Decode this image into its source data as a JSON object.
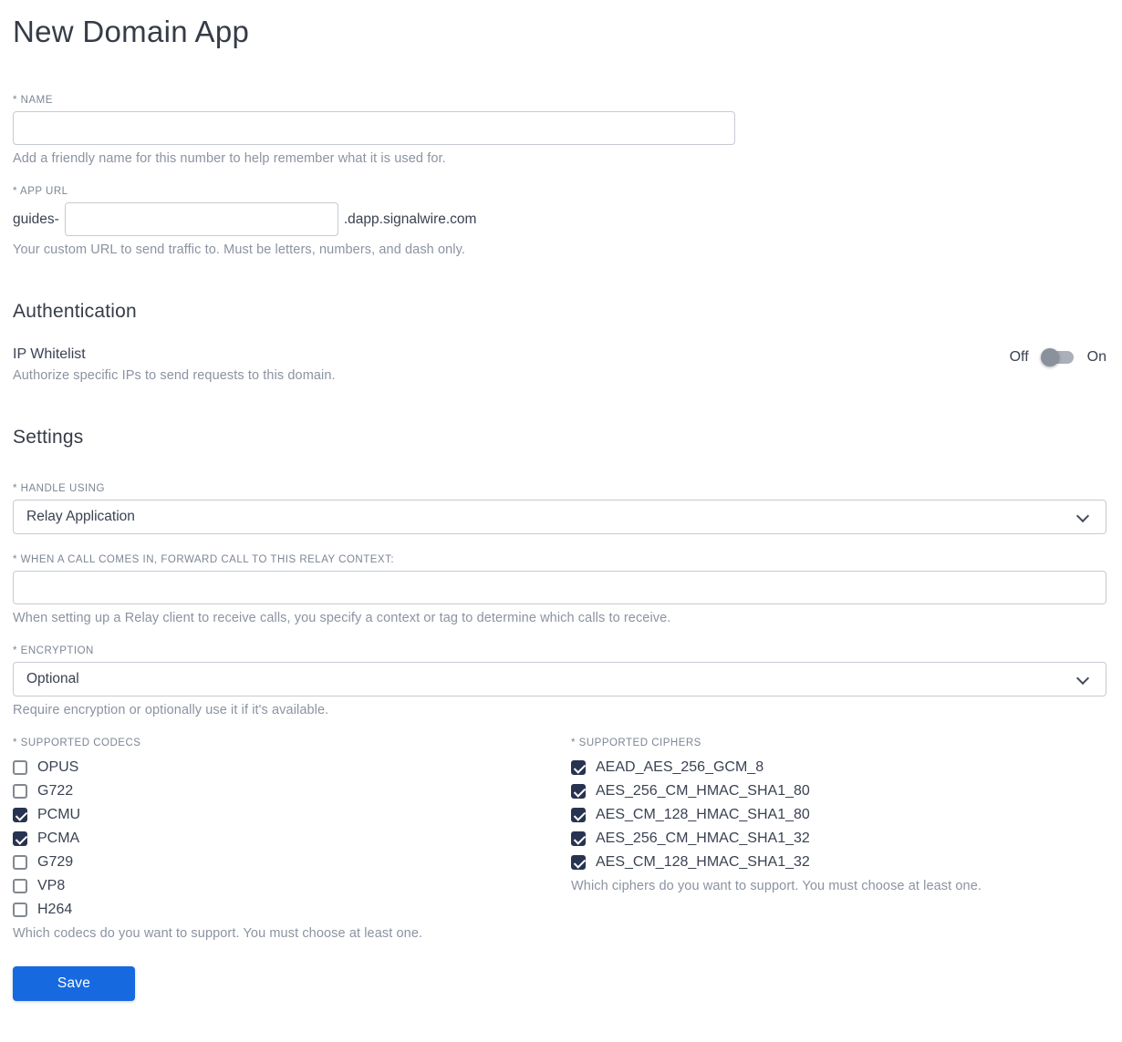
{
  "page": {
    "title": "New Domain App"
  },
  "name_field": {
    "label": "* NAME",
    "value": "",
    "helper": "Add a friendly name for this number to help remember what it is used for."
  },
  "app_url_field": {
    "label": "* APP URL",
    "prefix": "guides-",
    "value": "",
    "suffix": ".dapp.signalwire.com",
    "helper": "Your custom URL to send traffic to. Must be letters, numbers, and dash only."
  },
  "authentication": {
    "heading": "Authentication",
    "ip_whitelist": {
      "label": "IP Whitelist",
      "helper": "Authorize specific IPs to send requests to this domain.",
      "off_label": "Off",
      "on_label": "On",
      "enabled": false
    }
  },
  "settings": {
    "heading": "Settings",
    "handle_using": {
      "label": "* HANDLE USING",
      "value": "Relay Application"
    },
    "relay_context": {
      "label": "* WHEN A CALL COMES IN, FORWARD CALL TO THIS RELAY CONTEXT:",
      "value": "",
      "helper": "When setting up a Relay client to receive calls, you specify a context or tag to determine which calls to receive."
    },
    "encryption": {
      "label": "* ENCRYPTION",
      "value": "Optional",
      "helper": "Require encryption or optionally use it if it's available."
    },
    "codecs": {
      "label": "* SUPPORTED CODECS",
      "helper": "Which codecs do you want to support. You must choose at least one.",
      "items": [
        {
          "label": "OPUS",
          "checked": false
        },
        {
          "label": "G722",
          "checked": false
        },
        {
          "label": "PCMU",
          "checked": true
        },
        {
          "label": "PCMA",
          "checked": true
        },
        {
          "label": "G729",
          "checked": false
        },
        {
          "label": "VP8",
          "checked": false
        },
        {
          "label": "H264",
          "checked": false
        }
      ]
    },
    "ciphers": {
      "label": "* SUPPORTED CIPHERS",
      "helper": "Which ciphers do you want to support. You must choose at least one.",
      "items": [
        {
          "label": "AEAD_AES_256_GCM_8",
          "checked": true
        },
        {
          "label": "AES_256_CM_HMAC_SHA1_80",
          "checked": true
        },
        {
          "label": "AES_CM_128_HMAC_SHA1_80",
          "checked": true
        },
        {
          "label": "AES_256_CM_HMAC_SHA1_32",
          "checked": true
        },
        {
          "label": "AES_CM_128_HMAC_SHA1_32",
          "checked": true
        }
      ]
    }
  },
  "actions": {
    "save_label": "Save"
  },
  "colors": {
    "accent_blue": "#1769e0",
    "checkbox_checked": "#273350",
    "heading_text": "#363c47",
    "label_text": "#7c8694",
    "helper_text": "#8b93a1",
    "body_text": "#3a4252",
    "input_border": "#c6cad1"
  }
}
